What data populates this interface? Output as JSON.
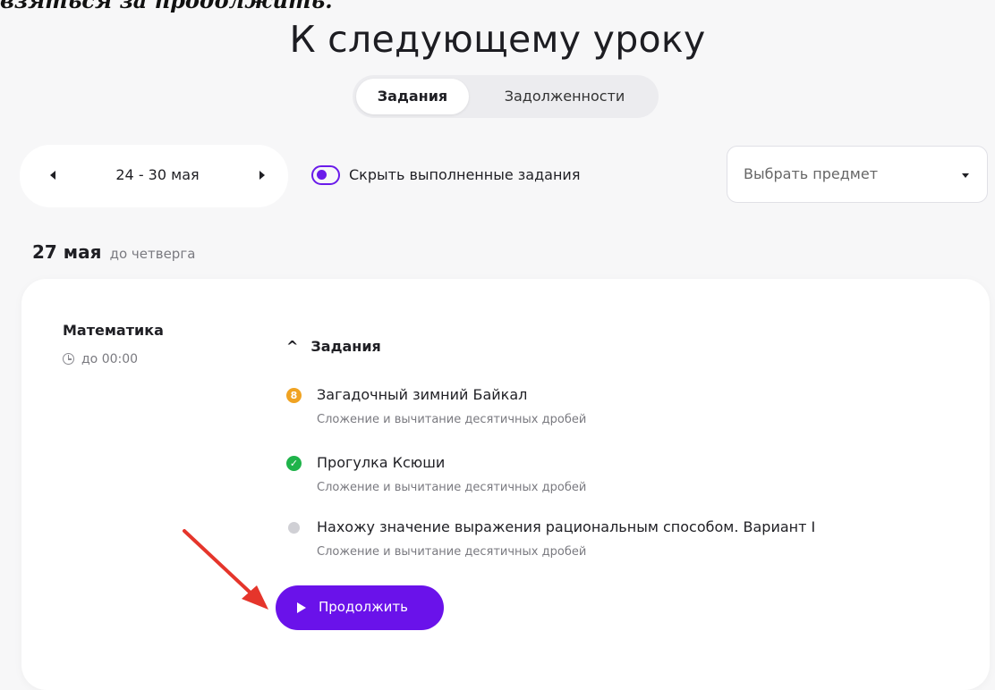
{
  "caption": {
    "text": "взяться за продолжить."
  },
  "page_title": "К следующему уроку",
  "tabs": [
    {
      "label": "Задания",
      "active": true
    },
    {
      "label": "Задолженности",
      "active": false
    }
  ],
  "week_selector": {
    "label": "24 - 30 мая"
  },
  "hide_completed": {
    "label": "Скрыть выполненные задания",
    "checked": true
  },
  "subject_filter": {
    "placeholder": "Выбрать предмет"
  },
  "day": {
    "date": "27 мая",
    "note": "до четверга"
  },
  "card": {
    "subject": "Математика",
    "deadline": "до 00:00",
    "tasks_header": "Задания",
    "tasks": [
      {
        "title": "Загадочный зимний Байкал",
        "subtitle": "Сложение и вычитание десятичных дробей",
        "status": "medal",
        "icon_glyph": "8"
      },
      {
        "title": "Прогулка Ксюши",
        "subtitle": "Сложение и вычитание десятичных дробей",
        "status": "done",
        "icon_glyph": "✓"
      },
      {
        "title": "Нахожу значение выражения рациональным способом. Вариант I",
        "subtitle": "Сложение и вычитание десятичных дробей",
        "status": "pending",
        "icon_glyph": ""
      }
    ],
    "continue_button": "Продолжить"
  },
  "colors": {
    "accent": "#6a12ea",
    "medal": "#f0a322",
    "done": "#1fb34a",
    "pending": "#d0d0d5",
    "annotation_arrow": "#e5352b"
  }
}
